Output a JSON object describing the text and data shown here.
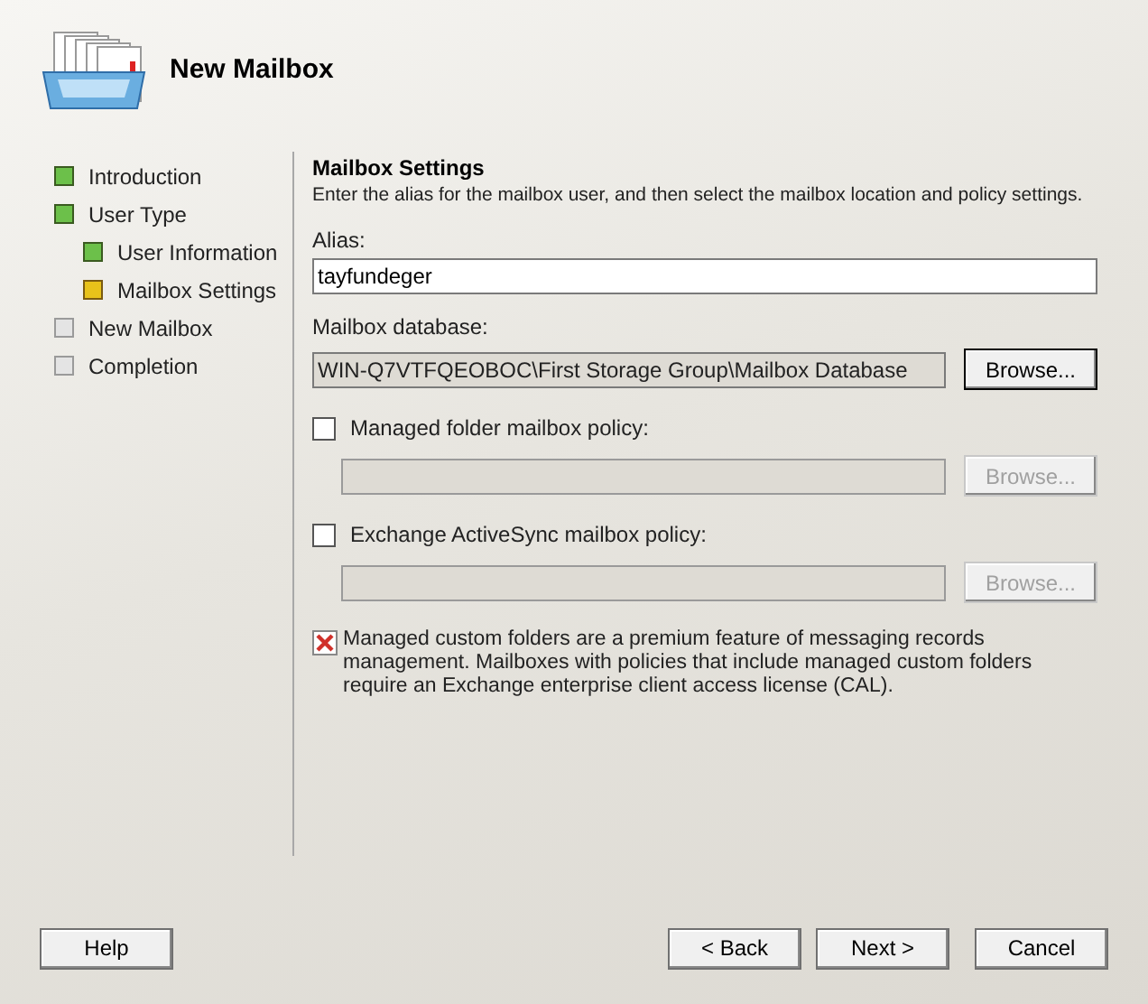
{
  "header": {
    "title": "New Mailbox"
  },
  "steps": [
    {
      "label": "Introduction",
      "completed": true,
      "current": false
    },
    {
      "label": "User Type",
      "completed": true,
      "current": false,
      "children": [
        {
          "label": "User Information",
          "completed": true,
          "current": false
        },
        {
          "label": "Mailbox Settings",
          "completed": false,
          "current": true
        }
      ]
    },
    {
      "label": "New Mailbox",
      "completed": false,
      "current": false
    },
    {
      "label": "Completion",
      "completed": false,
      "current": false
    }
  ],
  "page": {
    "title": "Mailbox Settings",
    "description": "Enter the alias for the mailbox user, and then select the mailbox location and policy settings.",
    "alias": {
      "label": "Alias:",
      "value": "tayfundeger"
    },
    "database": {
      "label": "Mailbox database:",
      "value": "WIN-Q7VTFQEOBOC\\First Storage Group\\Mailbox Database",
      "button": "Browse...",
      "disabled": false
    },
    "policies": [
      {
        "label": "Managed folder mailbox policy:",
        "checked": false,
        "button": "Browse...",
        "disabled": true
      },
      {
        "label": "Exchange ActiveSync mailbox policy:",
        "checked": false,
        "button": "Browse...",
        "disabled": true
      }
    ],
    "note": "Managed custom folders are a premium feature of messaging records management. Mailboxes with policies that include managed custom folders require an Exchange enterprise client access license (CAL)."
  },
  "buttons": {
    "help": "Help",
    "back": "< Back",
    "next": "Next >",
    "cancel": "Cancel"
  }
}
